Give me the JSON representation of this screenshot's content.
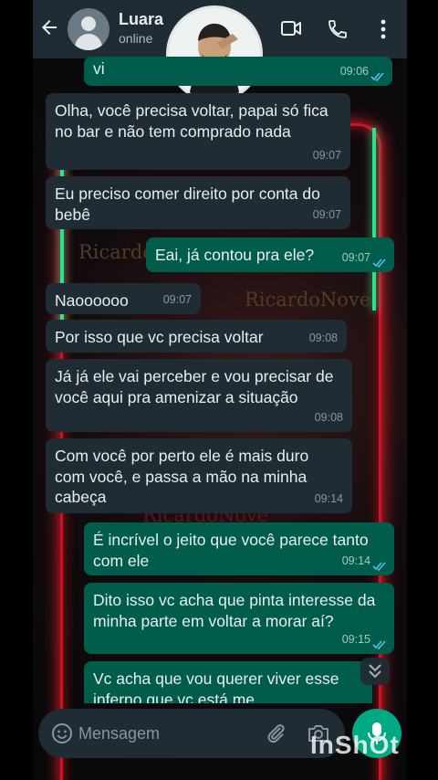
{
  "header": {
    "contact_name": "Luara",
    "status": "online"
  },
  "messages": [
    {
      "dir": "out",
      "text": "vi",
      "time": "09:06"
    },
    {
      "dir": "in",
      "text": "Olha, você precisa voltar, papai só fica no bar e não tem comprado nada",
      "time": "09:07"
    },
    {
      "dir": "in",
      "text": "Eu preciso comer direito por conta do bebê",
      "time": "09:07"
    },
    {
      "dir": "out",
      "text": "Eai, já contou pra ele?",
      "time": "09:07"
    },
    {
      "dir": "in",
      "text": "Naoooooo",
      "time": "09:07"
    },
    {
      "dir": "in",
      "text": "Por isso que vc precisa voltar",
      "time": "09:08"
    },
    {
      "dir": "in",
      "text": "Já já ele vai perceber e vou precisar de você aqui pra amenizar a situação",
      "time": "09:08"
    },
    {
      "dir": "in",
      "text": "Com você por perto ele é mais duro com você, e passa a mão na minha cabeça",
      "time": "09:14"
    },
    {
      "dir": "out",
      "text": "É incrível o jeito que você parece tanto com ele",
      "time": "09:14"
    },
    {
      "dir": "out",
      "text": "Dito isso vc acha que pinta interesse da minha parte em voltar a morar aí?",
      "time": "09:15"
    },
    {
      "dir": "out",
      "text": "Vc acha que vou querer viver esse inferno que vc está me",
      "time": ""
    }
  ],
  "wallpaper_text": [
    "RicardoNove",
    "RicardoNove",
    "RicardoNove"
  ],
  "input": {
    "placeholder": "Mensagem"
  },
  "overlay": {
    "watermark": "InShOt"
  },
  "colors": {
    "header": "#1f2c33",
    "incoming": "#1f2c33",
    "outgoing": "#005c4b",
    "accent": "#00a884"
  }
}
